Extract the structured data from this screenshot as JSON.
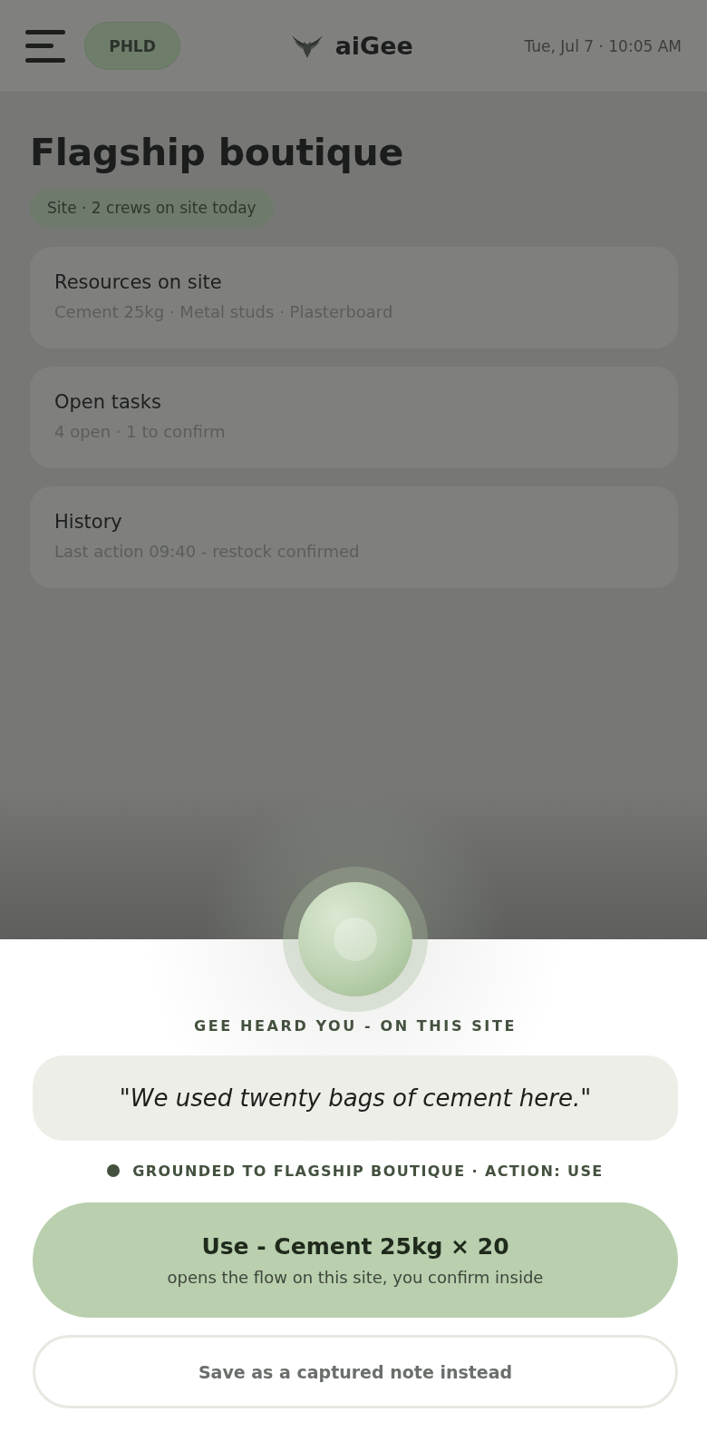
{
  "header": {
    "badge": "PHLD",
    "brand": "aiGee",
    "datetime": "Tue, Jul 7 · 10:05 AM"
  },
  "site": {
    "title": "Flagship boutique",
    "chip": "Site · 2 crews on site today",
    "cards": [
      {
        "title": "Resources on site",
        "subtitle": "Cement 25kg · Metal studs · Plasterboard"
      },
      {
        "title": "Open tasks",
        "subtitle": "4 open · 1 to confirm"
      },
      {
        "title": "History",
        "subtitle": "Last action 09:40 - restock confirmed"
      }
    ]
  },
  "voice_sheet": {
    "heading": "GEE HEARD YOU - ON THIS SITE",
    "transcript": "\"We used twenty bags of cement here.\"",
    "grounding": "GROUNDED TO FLAGSHIP BOUTIQUE · ACTION: USE",
    "actions": [
      {
        "kind": "primary",
        "label": "Use - Cement 25kg × 20",
        "hint": "opens the flow on this site, you confirm inside"
      },
      {
        "kind": "secondary",
        "label": "Save as a captured note instead"
      }
    ]
  }
}
